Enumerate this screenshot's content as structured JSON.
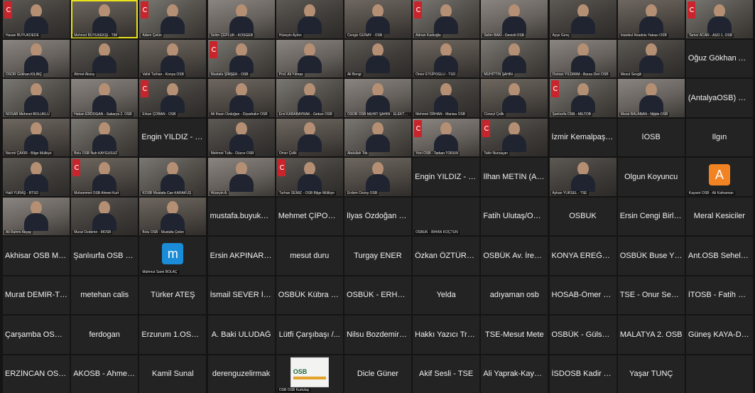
{
  "meeting": {
    "tiles": [
      {
        "label": "Hasan BÜYÜKDEDE",
        "video": true,
        "flag": true
      },
      {
        "label": "Mehmet BÜYÜKEKŞİ - TİM",
        "video": true,
        "active": true
      },
      {
        "label": "Adem Çekin",
        "video": true,
        "flag": true
      },
      {
        "label": "Selim ÇEPLÜK - KOSGEB",
        "video": true
      },
      {
        "label": "Hüseyin Aydın",
        "video": true
      },
      {
        "label": "Cengiz GÜNAY - OSB",
        "video": true
      },
      {
        "label": "Adnan Kadıoğlu",
        "video": true,
        "flag": true
      },
      {
        "label": "Selim BAKİ - Denizli OSB",
        "video": true
      },
      {
        "label": "Ayşe Genç",
        "video": true
      },
      {
        "label": "İstanbul Anadolu Yakası OSB",
        "video": true
      },
      {
        "label": "Tamer ACAR - ASO 1. OSB",
        "video": true,
        "flag": true
      },
      {
        "label": "OSOR Gökhan KILINÇ",
        "video": true
      },
      {
        "label": "Ahmet Aksoy",
        "video": true
      },
      {
        "label": "Vahit Turhan - Konya OSB",
        "video": true
      },
      {
        "label": "Mustafa ŞİMŞEK - OSB",
        "video": true,
        "flag": true
      },
      {
        "label": "Prof. Ali Yılmaz",
        "video": true
      },
      {
        "label": "Ali Bengi",
        "video": true
      },
      {
        "label": "Ömer EYÜPOĞLU - TSO",
        "video": true
      },
      {
        "label": "MUHİTTİN ŞAHİN",
        "video": true
      },
      {
        "label": "Osman YILDIRIM - Bursa Deri OSB",
        "video": true
      },
      {
        "label": "Mesut Sevgili",
        "video": true
      },
      {
        "name": "Oğuz Gökhan AS..."
      },
      {
        "label": "NOSAB Mehmet BOLUKLU",
        "video": true
      },
      {
        "label": "Hakan ERDOĞAN - Sakarya 2. OSB",
        "video": true
      },
      {
        "label": "Erkan ÇOBAN - OSB",
        "video": true,
        "flag": true
      },
      {
        "label": "Ali İhsan Özdoğan - Diyarbakır OSB",
        "video": true
      },
      {
        "label": "Erol KARABAYRAK - Gebze OSB",
        "video": true
      },
      {
        "label": "OSOB OSB MUHİT ŞAHİN - ELEKTRİK",
        "video": true
      },
      {
        "label": "Mehmet ORHAN - Manisa OSB",
        "video": true
      },
      {
        "label": "Cüneyt Çelik",
        "video": true
      },
      {
        "label": "Şanlıurfa OSB - MİLTOB",
        "video": true,
        "flag": true
      },
      {
        "label": "Murat BALABAN - Niğde OSB",
        "video": true
      },
      {
        "name": "(AntalyaOSB) Hü..."
      },
      {
        "label": "Necmi ÇAKIR - Bilge Mülkiye",
        "video": true
      },
      {
        "label": "Bolu OSB Nuh KAYGUSUZ",
        "video": true
      },
      {
        "name": "Engin YILDIZ - K..."
      },
      {
        "label": "Mehmet Tutlu - Düzce OSB",
        "video": true
      },
      {
        "label": "Ömer Çelik",
        "video": true
      },
      {
        "label": "Abdullah Tok",
        "video": true
      },
      {
        "label": "Yeni OSB - Tarkan TORUN",
        "video": true,
        "flag": true
      },
      {
        "label": "Tahir Nursaçan",
        "video": true,
        "flag": true
      },
      {
        "name": "İzmir Kemalpaşa..."
      },
      {
        "name": "İOSB"
      },
      {
        "name": "Ilgın"
      },
      {
        "label": "Halil YURAŞ - BTSO",
        "video": true
      },
      {
        "label": "Muhammet OSB Ahmet Kurt",
        "video": true,
        "flag": true
      },
      {
        "label": "KOSB Mustafa Can KARAKUŞ",
        "video": true
      },
      {
        "label": "Hüseyin A.",
        "video": true
      },
      {
        "label": "Turhan SEMİZ - OSB Bilge Mülkiye",
        "video": true,
        "flag": true
      },
      {
        "label": "Erdem Özsoy OSB",
        "video": true
      },
      {
        "name": "Engin YILDIZ - K..."
      },
      {
        "name": "İlhan METİN (AN..."
      },
      {
        "label": "Ayhan YÜKSEL - TSE",
        "video": true
      },
      {
        "name": "Olgun Koyuncu"
      },
      {
        "avatar": "A",
        "avatarColor": "#f28322",
        "label": "Kayseri OSB - Ali Kahraman"
      },
      {
        "label": "Ali Rahmi Akçay",
        "video": true
      },
      {
        "label": "Murat Özdemir - MOSB",
        "video": true
      },
      {
        "label": "Bolu OSB - Mustafa Çelen",
        "video": true
      },
      {
        "name": "mustafa.buyukeg..."
      },
      {
        "name": "Mehmet ÇİPOĞL..."
      },
      {
        "name": "İlyas Özdoğan - T..."
      },
      {
        "label": "OSBÜK - BİHAN KOÇTÜN"
      },
      {
        "name": "Fatih Ulutaş/OSB..."
      },
      {
        "name": "OSBUK"
      },
      {
        "name": "Ersin Cengi Birlik..."
      },
      {
        "name": "Meral Kesiciler"
      },
      {
        "name": "Akhisar OSB Met..."
      },
      {
        "name": "Şanlıurfa OSB Böl..."
      },
      {
        "avatar": "m",
        "avatarColor": "#1a8cd8",
        "label": "Mahmut Sami BOLAÇ"
      },
      {
        "name": "Ersin AKPINAR (A..."
      },
      {
        "name": "mesut duru"
      },
      {
        "name": "Turgay ENER"
      },
      {
        "name": "Özkan ÖZTÜRK-..."
      },
      {
        "name": "OSBÜK Av. İrem..."
      },
      {
        "name": "KONYA EREĞLİ..."
      },
      {
        "name": "OSBÜK Buse YIL..."
      },
      {
        "name": "Ant.OSB Sehel S..."
      },
      {
        "name": "Murat DEMİR-TO..."
      },
      {
        "name": "metehan calis"
      },
      {
        "name": "Türker ATEŞ"
      },
      {
        "name": "İsmail SEVER İAY..."
      },
      {
        "name": "OSBÜK Kübra Öz..."
      },
      {
        "name": "OSBÜK - ERHAN..."
      },
      {
        "name": "Yelda"
      },
      {
        "name": "adıyaman osb"
      },
      {
        "name": "HOSAB-Ömer Fa..."
      },
      {
        "name": "TSE - Onur Seçkin"
      },
      {
        "name": "İTOSB - Fatih DU..."
      },
      {
        "name": "Çarşamba OSB-..."
      },
      {
        "name": "ferdogan"
      },
      {
        "name": "Erzurum 1.OSB İh..."
      },
      {
        "name": "A. Baki ULUDAĞ"
      },
      {
        "name": "Lütfi Çarşıbaşı /..."
      },
      {
        "name": "Nilsu Bozdemir -..."
      },
      {
        "name": "Hakkı Yazıcı Trab..."
      },
      {
        "name": "TSE-Mesut Mete"
      },
      {
        "name": "OSBÜK - Gülsem..."
      },
      {
        "name": "MALATYA 2. OSB"
      },
      {
        "name": "Güneş KAYA-DO..."
      },
      {
        "name": "ERZİNCAN OSB..."
      },
      {
        "name": "AKOSB - Ahmet..."
      },
      {
        "name": "Kamil Sunal"
      },
      {
        "name": "derenguzelirmak"
      },
      {
        "logo": "OSB",
        "label": "OSB OSB Kurtuluş"
      },
      {
        "name": "Dicle Güner"
      },
      {
        "name": "Akif Sesli - TSE"
      },
      {
        "name": "Ali Yaprak-Kayser..."
      },
      {
        "name": "İSDOSB Kadir Te..."
      },
      {
        "name": "Yaşar TUNÇ"
      },
      {}
    ]
  }
}
